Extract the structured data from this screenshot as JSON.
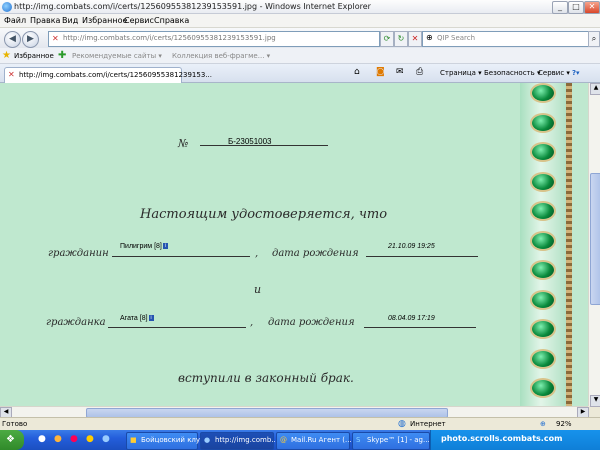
{
  "window": {
    "title": "http://img.combats.com/i/certs/12560955381239153591.jpg - Windows Internet Explorer"
  },
  "menu": [
    "Файл",
    "Правка",
    "Вид",
    "Избранное",
    "Сервис",
    "Справка"
  ],
  "address": {
    "url": "http://img.combats.com/i/certs/12560955381239153591.jpg"
  },
  "search": {
    "placeholder": "QIP Search"
  },
  "favorites": {
    "label": "Избранное",
    "items": [
      "Рекомендуемые сайты ▾",
      "Коллекция веб-фрагме... ▾"
    ]
  },
  "tab": {
    "title": "http://img.combats.com/i/certs/12560955381239153..."
  },
  "commands": {
    "page": "Страница ▾",
    "security": "Безопасность ▾",
    "tools": "Сервис ▾"
  },
  "certificate": {
    "number_label": "№",
    "number": "Б-23051003",
    "heading": "Настоящим удостоверяется, что",
    "citizen_label": "гражданин",
    "citizen_name": "Пилигрим",
    "citizen_level": "[8]",
    "birth_label": "дата рождения",
    "citizen_birth": "21.10.09 19:25",
    "and": "и",
    "citizen2_label": "гражданка",
    "citizen2_name": "Агата",
    "citizen2_level": "[8]",
    "birth2_label": "дата рождения",
    "citizen2_birth": "08.04.09 17:19",
    "footer": "вступили в законный брак."
  },
  "status": {
    "text": "Готово",
    "zone": "Интернет",
    "zoom": "92%"
  },
  "taskbar": {
    "items": [
      "Бойцовский клуб ...",
      "http://img.comb...",
      "Mail.Ru Агент (...",
      "Skype™ [1] - ag..."
    ],
    "watermark": "photo.scrolls.combats.com"
  },
  "colors": {
    "cert_bg": "#bfe8cf",
    "taskbar": "#245edb",
    "gem": "#0a8a3c"
  }
}
